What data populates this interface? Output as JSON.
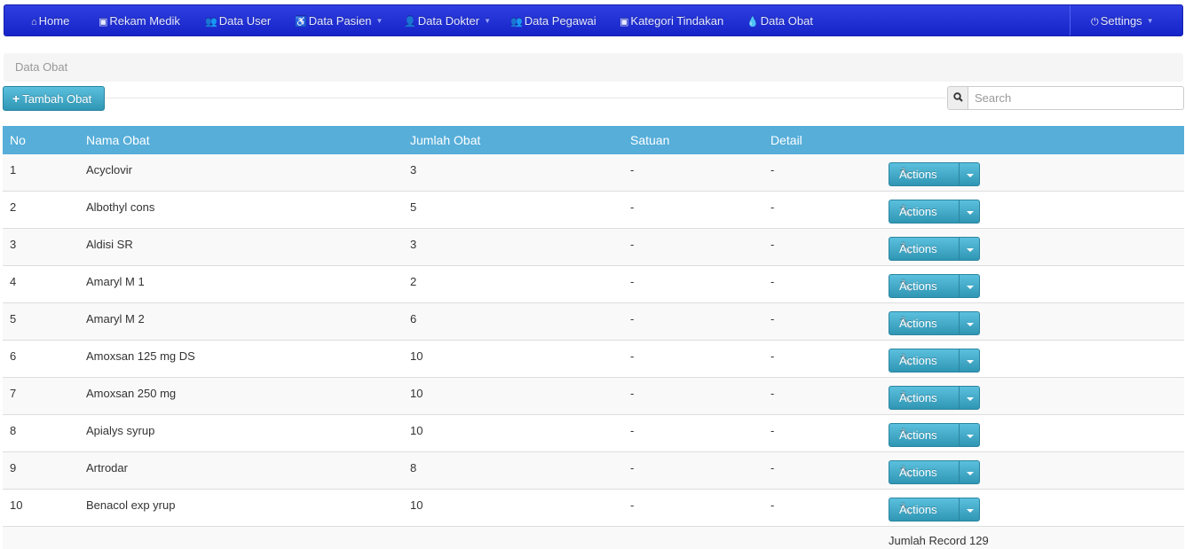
{
  "navbar": {
    "items": [
      {
        "icon": "⌂",
        "label": "Home",
        "dropdown": false
      },
      {
        "icon": "▣",
        "label": "Rekam Medik",
        "dropdown": false
      },
      {
        "icon": "👥",
        "label": "Data User",
        "dropdown": false
      },
      {
        "icon": "♿",
        "label": "Data Pasien",
        "dropdown": true
      },
      {
        "icon": "👤",
        "label": "Data Dokter",
        "dropdown": true
      },
      {
        "icon": "👥",
        "label": "Data Pegawai",
        "dropdown": false
      },
      {
        "icon": "▣",
        "label": "Kategori Tindakan",
        "dropdown": false
      },
      {
        "icon": "💧",
        "label": "Data Obat",
        "dropdown": false
      }
    ],
    "settings": {
      "icon": "⏻",
      "label": "Settings"
    }
  },
  "breadcrumb": {
    "label": "Data Obat"
  },
  "toolbar": {
    "add_label": "Tambah Obat",
    "search_placeholder": "Search",
    "search_value": ""
  },
  "table": {
    "headers": {
      "no": "No",
      "nama": "Nama Obat",
      "jumlah": "Jumlah Obat",
      "satuan": "Satuan",
      "detail": "Detail"
    },
    "action_label": "Actions",
    "rows": [
      {
        "no": "1",
        "nama": "Acyclovir",
        "jumlah": "3",
        "satuan": "-",
        "detail": "-"
      },
      {
        "no": "2",
        "nama": "Albothyl cons",
        "jumlah": "5",
        "satuan": "-",
        "detail": "-"
      },
      {
        "no": "3",
        "nama": "Aldisi SR",
        "jumlah": "3",
        "satuan": "-",
        "detail": "-"
      },
      {
        "no": "4",
        "nama": "Amaryl M 1",
        "jumlah": "2",
        "satuan": "-",
        "detail": "-"
      },
      {
        "no": "5",
        "nama": "Amaryl M 2",
        "jumlah": "6",
        "satuan": "-",
        "detail": "-"
      },
      {
        "no": "6",
        "nama": "Amoxsan 125 mg DS",
        "jumlah": "10",
        "satuan": "-",
        "detail": "-"
      },
      {
        "no": "7",
        "nama": "Amoxsan 250 mg",
        "jumlah": "10",
        "satuan": "-",
        "detail": "-"
      },
      {
        "no": "8",
        "nama": "Apialys syrup",
        "jumlah": "10",
        "satuan": "-",
        "detail": "-"
      },
      {
        "no": "9",
        "nama": "Artrodar",
        "jumlah": "8",
        "satuan": "-",
        "detail": "-"
      },
      {
        "no": "10",
        "nama": "Benacol exp yrup",
        "jumlah": "10",
        "satuan": "-",
        "detail": "-"
      }
    ],
    "footer": "Jumlah Record 129"
  }
}
